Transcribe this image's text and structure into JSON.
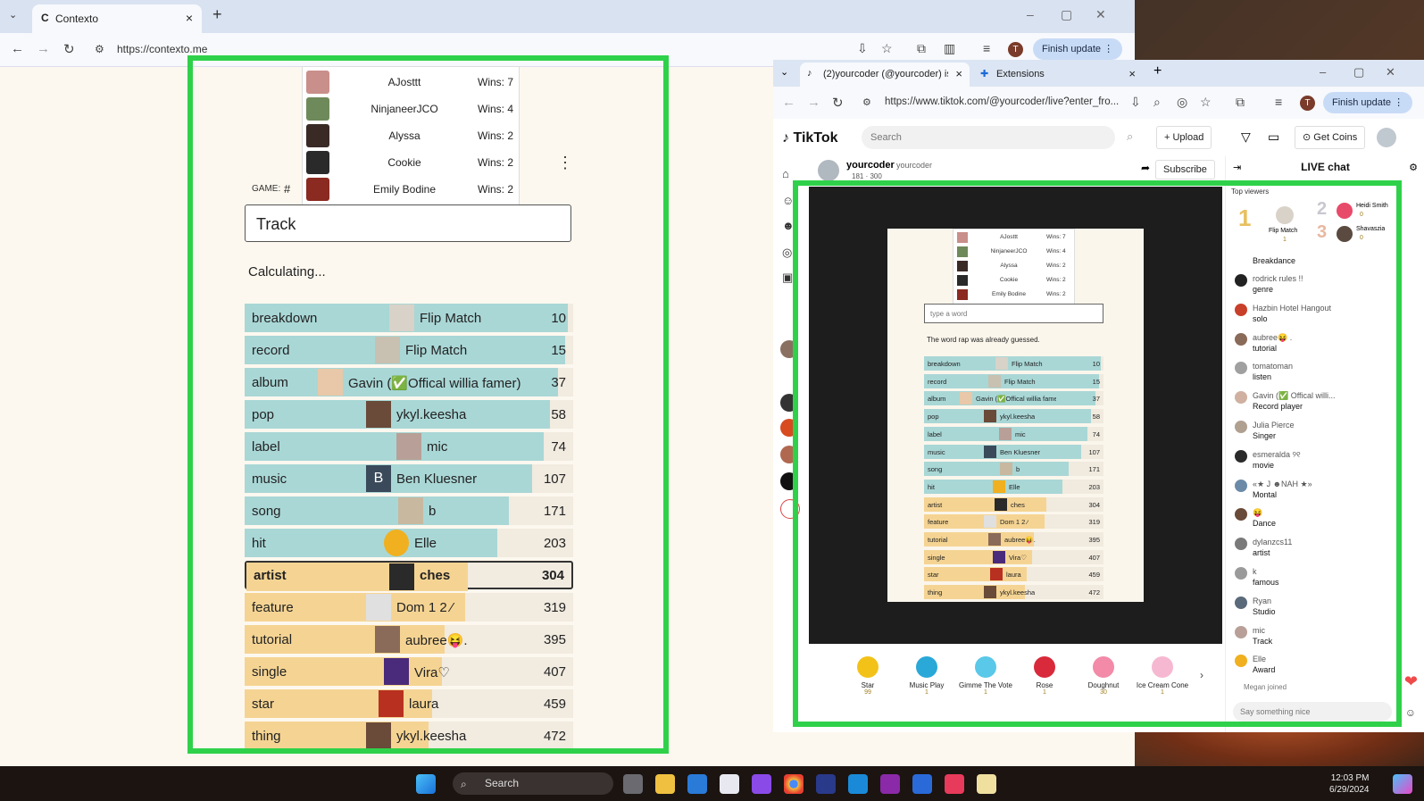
{
  "left_browser": {
    "tab_title": "Contexto",
    "url": "https://contexto.me",
    "finish_update": "Finish update",
    "profile_letter": "T"
  },
  "contexto": {
    "game_label": "GAME:",
    "game_hash": "#",
    "input_value": "Track",
    "status": "Calculating...",
    "leaderboard": [
      {
        "name": "AJosttt",
        "wins": "Wins: 7",
        "color": "#c98f8a"
      },
      {
        "name": "NinjaneerJCO",
        "wins": "Wins: 4",
        "color": "#6f8a5a"
      },
      {
        "name": "Alyssa",
        "wins": "Wins: 2",
        "color": "#3a2a26"
      },
      {
        "name": "Cookie",
        "wins": "Wins: 2",
        "color": "#2a2a2a"
      },
      {
        "name": "Emily Bodine",
        "wins": "Wins: 2",
        "color": "#8a2a20"
      }
    ],
    "guesses": [
      {
        "word": "breakdown",
        "who": "Flip Match",
        "rank": "10",
        "fraction": 0.985,
        "color": "#a9d7d6"
      },
      {
        "word": "record",
        "who": "Flip Match",
        "rank": "15",
        "fraction": 0.975,
        "color": "#a9d7d6"
      },
      {
        "word": "album",
        "who": "Gavin (✅Offical willia famer)",
        "rank": "37",
        "fraction": 0.955,
        "color": "#a9d7d6"
      },
      {
        "word": "pop",
        "who": "ykyl.keesha",
        "rank": "58",
        "fraction": 0.93,
        "color": "#a9d7d6"
      },
      {
        "word": "label",
        "who": "mic",
        "rank": "74",
        "fraction": 0.91,
        "color": "#a9d7d6"
      },
      {
        "word": "music",
        "who": "Ben Kluesner",
        "rank": "107",
        "fraction": 0.875,
        "color": "#a9d7d6"
      },
      {
        "word": "song",
        "who": "b",
        "rank": "171",
        "fraction": 0.805,
        "color": "#a9d7d6"
      },
      {
        "word": "hit",
        "who": "Elle",
        "rank": "203",
        "fraction": 0.77,
        "color": "#a9d7d6"
      },
      {
        "word": "artist",
        "who": "ches",
        "rank": "304",
        "fraction": 0.68,
        "color": "#f5d493"
      },
      {
        "word": "feature",
        "who": "Dom 1 2 ⁄",
        "rank": "319",
        "fraction": 0.67,
        "color": "#f5d493"
      },
      {
        "word": "tutorial",
        "who": "aubree😝.",
        "rank": "395",
        "fraction": 0.61,
        "color": "#f5d493"
      },
      {
        "word": "single",
        "who": "Vira♡",
        "rank": "407",
        "fraction": 0.6,
        "color": "#f5d493"
      },
      {
        "word": "star",
        "who": "laura",
        "rank": "459",
        "fraction": 0.57,
        "color": "#f5d493"
      },
      {
        "word": "thing",
        "who": "ykyl.keesha",
        "rank": "472",
        "fraction": 0.56,
        "color": "#f5d493"
      }
    ],
    "guess_avatar_colors": [
      "#d8d2c8",
      "#c8c0b0",
      "#e8c8a8",
      "#6a4a38",
      "#b8a098",
      "#3a4a5a",
      "#c8b8a0",
      "#f0b020",
      "#2a2a2a",
      "#e0e0e0",
      "#8a6a58",
      "#4a2a7a",
      "#b83020",
      "#6a4a38"
    ],
    "music_avatar_letter": "B"
  },
  "right_browser": {
    "tab1_title": "(2)yourcoder (@yourcoder) is LI",
    "tab2_title": "Extensions",
    "url": "https://www.tiktok.com/@yourcoder/live?enter_fro...",
    "finish_update": "Finish update",
    "profile_letter": "T"
  },
  "tiktok": {
    "logo": "TikTok",
    "search_placeholder": "Search",
    "upload": "Upload",
    "get_coins": "Get Coins",
    "host_name": "yourcoder",
    "host_handle": "yourcoder",
    "host_stats": "181 · 300",
    "subscribe": "Subscribe",
    "live_chat": "LIVE chat",
    "top_viewers": "Top viewers",
    "top1_name": "Flip Match",
    "top1_coins": "1",
    "top2_name": "Heidi Smith",
    "top2_coins": "0",
    "top3_name": "Shavaszia",
    "top3_coins": "0",
    "say_placeholder": "Say something nice",
    "stream_input_placeholder": "type a word",
    "stream_message": "The word rap was already guessed.",
    "gifts": [
      {
        "name": "Star",
        "price": "99",
        "color": "#f3c218"
      },
      {
        "name": "Music Play",
        "price": "1",
        "color": "#2aa8d8"
      },
      {
        "name": "Gimme The Vote",
        "price": "1",
        "color": "#5ac8e8"
      },
      {
        "name": "Rose",
        "price": "1",
        "color": "#d82a3a"
      },
      {
        "name": "Doughnut",
        "price": "30",
        "color": "#f28aa8"
      },
      {
        "name": "Ice Cream Cone",
        "price": "1",
        "color": "#f6b8d0"
      }
    ],
    "chat": [
      {
        "name": "",
        "text": "Breakdance",
        "color": "#ffffff"
      },
      {
        "name": "rodrick rules !!",
        "text": "genre",
        "color": "#222222"
      },
      {
        "name": "Hazbin Hotel Hangout",
        "text": "solo",
        "color": "#c8402a"
      },
      {
        "name": "aubree😝 .",
        "text": "tutorial",
        "color": "#8a6a58"
      },
      {
        "name": "tomatoman",
        "text": "listen",
        "color": "#a0a0a0"
      },
      {
        "name": "Gavin (✅ Offical willi...",
        "text": "Record player",
        "color": "#d0b0a0"
      },
      {
        "name": "Julia Pierce",
        "text": "Singer",
        "color": "#b0a090"
      },
      {
        "name": "esmeralda ୨୧",
        "text": "movie",
        "color": "#2a2a2a"
      },
      {
        "name": "«★ J ☻NAH ★»",
        "text": "Montal",
        "color": "#6a8aa8"
      },
      {
        "name": "😝",
        "text": "Dance",
        "color": "#6a4a38"
      },
      {
        "name": "dylanzcs11",
        "text": "artist",
        "color": "#7a7a7a"
      },
      {
        "name": "k",
        "text": "famous",
        "color": "#9a9a9a"
      },
      {
        "name": "Ryan",
        "text": "Studio",
        "color": "#5a6a7a"
      },
      {
        "name": "mic",
        "text": "Track",
        "color": "#b8a098"
      },
      {
        "name": "Elle",
        "text": "Award",
        "color": "#f0b020"
      },
      {
        "name": "Megan joined",
        "text": "",
        "color": "#ffffff"
      }
    ]
  },
  "taskbar": {
    "search": "Search",
    "time": "12:03 PM",
    "date": "6/29/2024"
  }
}
